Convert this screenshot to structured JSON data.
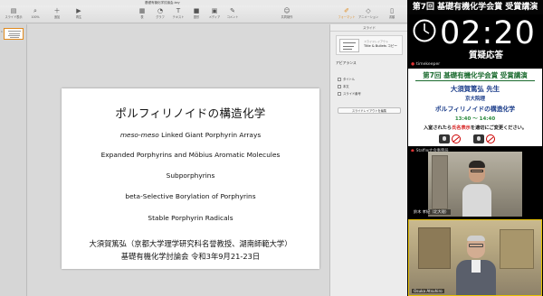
{
  "window": {
    "title": "基礎有機化学討論会.key"
  },
  "toolbar": {
    "buttons": [
      {
        "icon": "sidebar-icon",
        "label": "スライド表示"
      },
      {
        "icon": "zoom-icon",
        "label": "100%"
      },
      {
        "icon": "add-slide-icon",
        "label": "追加"
      },
      {
        "icon": "play-icon",
        "label": "再生"
      },
      {
        "icon": "table-icon",
        "label": "表"
      },
      {
        "icon": "chart-icon",
        "label": "グラフ"
      },
      {
        "icon": "text-icon",
        "label": "テキスト"
      },
      {
        "icon": "shape-icon",
        "label": "図形"
      },
      {
        "icon": "media-icon",
        "label": "メディア"
      },
      {
        "icon": "comment-icon",
        "label": "コメント"
      },
      {
        "icon": "collaborate-icon",
        "label": "共同制作"
      },
      {
        "icon": "format-icon",
        "label": "フォーマット"
      },
      {
        "icon": "animate-icon",
        "label": "アニメーション"
      },
      {
        "icon": "document-icon",
        "label": "書類"
      }
    ],
    "active_index": 11
  },
  "navigator": {
    "slide_number": "1"
  },
  "slide": {
    "title": "ポルフィリノイドの構造化学",
    "lines": [
      {
        "italic": "meso-meso",
        "text": " Linked Giant Porphyrin Arrays"
      },
      {
        "italic": "",
        "text": "Expanded Porphyrins and Möbius Aromatic Molecules"
      },
      {
        "italic": "",
        "text": "Subporphyrins"
      },
      {
        "italic": "",
        "text": "beta-Selective Borylation of Porphyrins"
      },
      {
        "italic": "",
        "text": "Stable Porphyrin Radicals"
      }
    ],
    "footer1": "大須賀篤弘（京都大学理学研究科名誉教授、湖南師範大学）",
    "footer2": "基礎有機化学討論会  令和3年9月21-23日"
  },
  "inspector": {
    "header": "スライド",
    "layout_caption": "スライドレイアウト",
    "layout_name": "Title & Bullets コピー",
    "appearance_title": "アピアランス",
    "checkboxes": [
      "タイトル",
      "本文",
      "スライド番号"
    ],
    "edit_button": "スライドレイアウトを編集"
  },
  "right_panel": {
    "event_title": "第7回 基礎有機化学会賞 受賞講演",
    "timer": "02:20",
    "session": "質疑応答",
    "timekeeper_label": "timekeeper",
    "card": {
      "title": "第7回 基礎有機化学会賞 受賞講演",
      "speaker": "大須賀篤弘 先生",
      "affiliation": "京大院理",
      "topic": "ポルフィリノイドの構造化学",
      "time": "13:40 ～ 14:40",
      "notice_pre": "入室されたら",
      "notice_red": "氏名表示",
      "notice_post": "を適切にご変更ください。"
    },
    "staff_label": "Staff@大会事務局",
    "video1_name": "鈴木 孝紀（北大理）",
    "video2_name": "Osuka Atsuhiro"
  },
  "colors": {
    "accent_orange": "#e08a1e",
    "card_green": "#1a6a2e",
    "card_blue": "#1b3d8a",
    "notice_red": "#d41818",
    "active_speaker_border": "#e8c200"
  }
}
